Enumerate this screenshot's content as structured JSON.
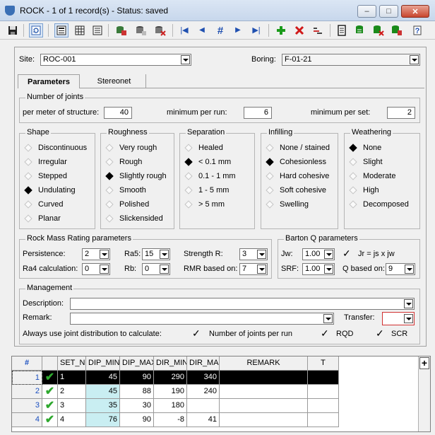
{
  "window": {
    "title": "ROCK - 1 of 1 record(s) - Status: saved",
    "min": "–",
    "max": "□",
    "close": "✕"
  },
  "toolbar": {
    "icons": [
      "save-icon",
      "refresh-icon",
      "form-view-icon",
      "grid-view-icon",
      "list-view-icon",
      "db-icon",
      "db2-icon",
      "db-delete-icon",
      "first-record-icon",
      "prev-record-icon",
      "goto-record-icon",
      "next-record-icon",
      "last-record-icon",
      "add-icon",
      "delete-icon",
      "sort-icon",
      "report-icon",
      "db-export-icon",
      "db-remove-icon",
      "db-link-icon",
      "help-icon"
    ],
    "nav": {
      "first": "|◀",
      "prev": "◀",
      "goto": "#",
      "next": "▶",
      "last": "▶|"
    }
  },
  "header": {
    "site_label": "Site:",
    "site_value": "ROC-001",
    "boring_label": "Boring:",
    "boring_value": "F-01-21"
  },
  "tabs": [
    {
      "label": "Parameters"
    },
    {
      "label": "Stereonet"
    }
  ],
  "joints": {
    "title": "Number of joints",
    "per_meter_label": "per meter of structure:",
    "per_meter_value": "40",
    "min_run_label": "minimum per run:",
    "min_run_value": "6",
    "min_set_label": "minimum per set:",
    "min_set_value": "2"
  },
  "shape": {
    "title": "Shape",
    "options": [
      "Discontinuous",
      "Irregular",
      "Stepped",
      "Undulating",
      "Curved",
      "Planar"
    ],
    "selected": 3
  },
  "roughness": {
    "title": "Roughness",
    "options": [
      "Very rough",
      "Rough",
      "Slightly rough",
      "Smooth",
      "Polished",
      "Slickensided"
    ],
    "selected": 2
  },
  "separation": {
    "title": "Separation",
    "options": [
      "Healed",
      "< 0.1 mm",
      "0.1 - 1 mm",
      "1 - 5 mm",
      "> 5 mm"
    ],
    "selected": 1
  },
  "infilling": {
    "title": "Infilling",
    "options": [
      "None / stained",
      "Cohesionless",
      "Hard cohesive",
      "Soft cohesive",
      "Swelling"
    ],
    "selected": 1
  },
  "weathering": {
    "title": "Weathering",
    "options": [
      "None",
      "Slight",
      "Moderate",
      "High",
      "Decomposed"
    ],
    "selected": 0
  },
  "rmr": {
    "title": "Rock Mass Rating parameters",
    "persistence_label": "Persistence:",
    "persistence_value": "2",
    "ra5_label": "Ra5:",
    "ra5_value": "15",
    "strength_label": "Strength R:",
    "strength_value": "3",
    "ra4_label": "Ra4 calculation:",
    "ra4_value": "0",
    "rb_label": "Rb:",
    "rb_value": "0",
    "rmr_based_label": "RMR based on:",
    "rmr_based_value": "7"
  },
  "barton": {
    "title": "Barton Q parameters",
    "jw_label": "Jw:",
    "jw_value": "1.00",
    "jr_label": "Jr = js x jw",
    "srf_label": "SRF:",
    "srf_value": "1.00",
    "q_based_label": "Q based on:",
    "q_based_value": "9"
  },
  "management": {
    "title": "Management",
    "description_label": "Description:",
    "description_value": "",
    "remark_label": "Remark:",
    "remark_value": "",
    "transfer_label": "Transfer:",
    "transfer_value": "",
    "always_label": "Always use joint distribution to calculate:",
    "joints_per_run_label": "Number of joints per run",
    "rqd_label": "RQD",
    "scr_label": "SCR"
  },
  "grid": {
    "headers": [
      "#",
      "",
      "SET_NO",
      "DIP_MIN",
      "DIP_MAX",
      "DIR_MIN",
      "DIR_MAX",
      "REMARK",
      "T"
    ],
    "rows": [
      {
        "n": "1",
        "set": "1",
        "dip_min": "45",
        "dip_max": "90",
        "dir_min": "290",
        "dir_max": "340"
      },
      {
        "n": "2",
        "set": "2",
        "dip_min": "45",
        "dip_max": "88",
        "dir_min": "190",
        "dir_max": "240"
      },
      {
        "n": "3",
        "set": "3",
        "dip_min": "35",
        "dip_max": "30",
        "dir_min": "180",
        "dir_max": ""
      },
      {
        "n": "4",
        "set": "4",
        "dip_min": "76",
        "dip_max": "90",
        "dir_min": "-8",
        "dir_max": "41"
      }
    ],
    "add_label": "+"
  }
}
